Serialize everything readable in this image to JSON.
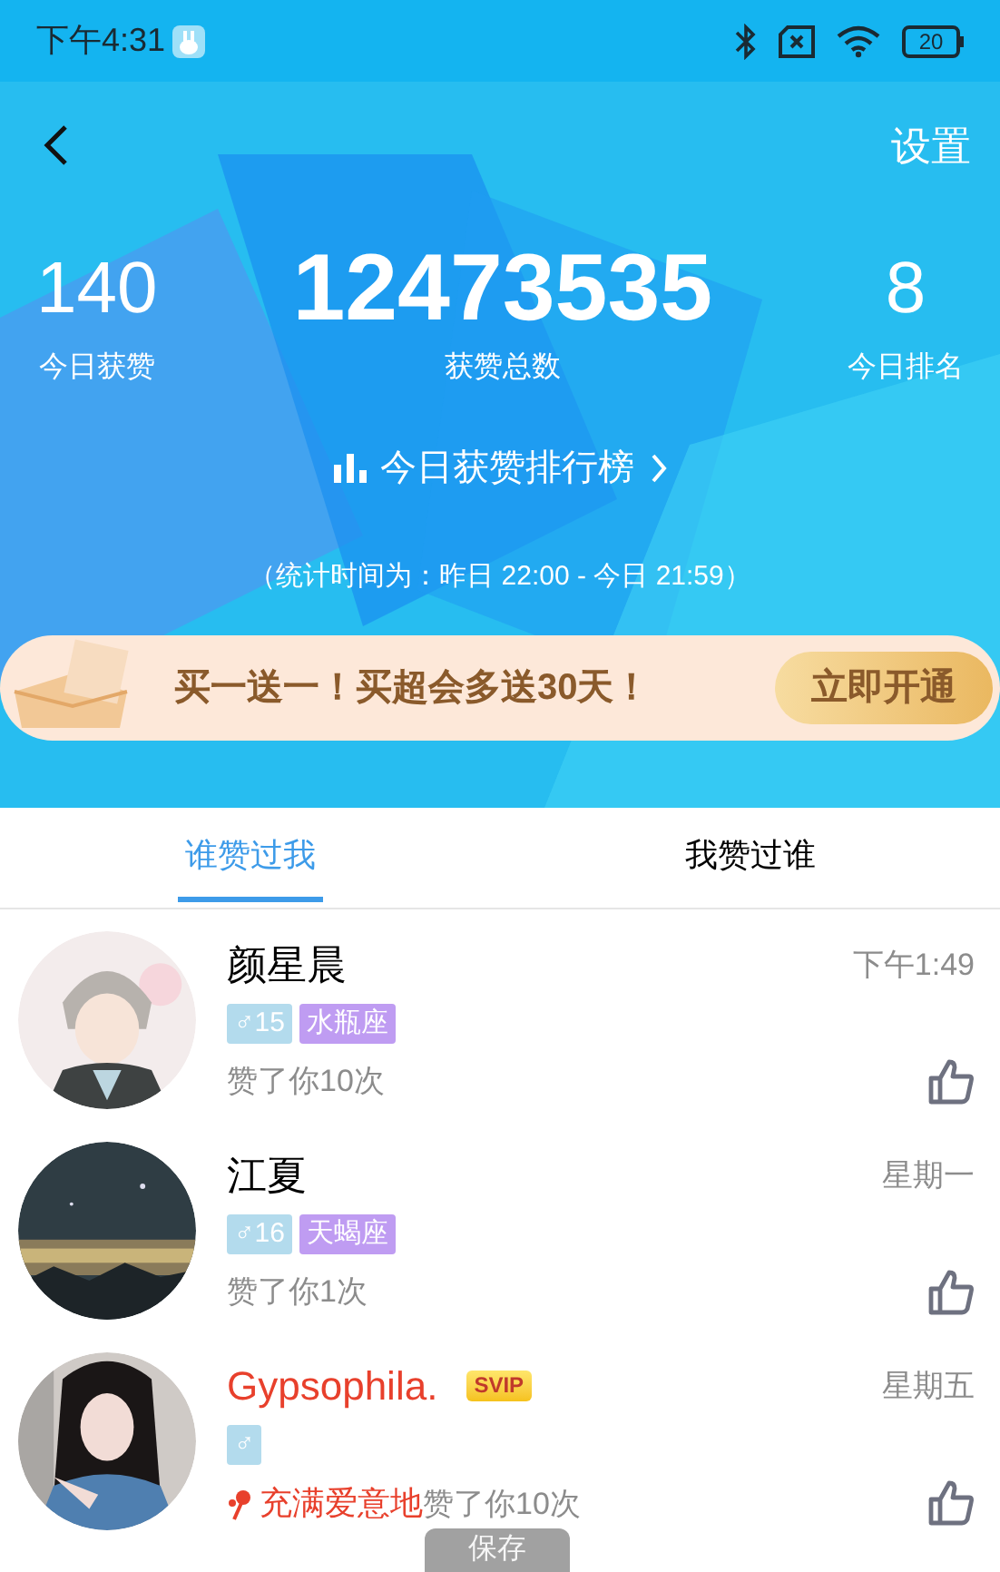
{
  "status_bar": {
    "time": "下午4:31",
    "battery": "20"
  },
  "header": {
    "settings": "设置"
  },
  "stats": [
    {
      "value": "140",
      "label": "今日获赞"
    },
    {
      "value": "12473535",
      "label": "获赞总数"
    },
    {
      "value": "8",
      "label": "今日排名"
    }
  ],
  "ranking_link": "今日获赞排行榜",
  "stats_period": "（统计时间为：昨日 22:00 - 今日 21:59）",
  "banner": {
    "text": "**买一送一！**买超会**多送**30天！",
    "button": "立即开通"
  },
  "tabs": [
    {
      "label": "谁赞过我",
      "selected": true
    },
    {
      "label": "我赞过谁",
      "selected": false
    }
  ],
  "likes": [
    {
      "name": "颜星晨",
      "svip": false,
      "time": "下午1:49",
      "gender": "♂",
      "age": "15",
      "zodiac": "水瓶座",
      "note": "赞了你10次"
    },
    {
      "name": "江夏",
      "svip": false,
      "time": "星期一",
      "gender": "♂",
      "age": "16",
      "zodiac": "天蝎座",
      "note": "赞了你1次"
    },
    {
      "name": "Gypsophila.",
      "svip": true,
      "badge": "SVIP",
      "time": "星期五",
      "gender": "♂",
      "note_prefix": "充满爱意地",
      "note": "赞了你10次"
    }
  ],
  "toast": "保存"
}
